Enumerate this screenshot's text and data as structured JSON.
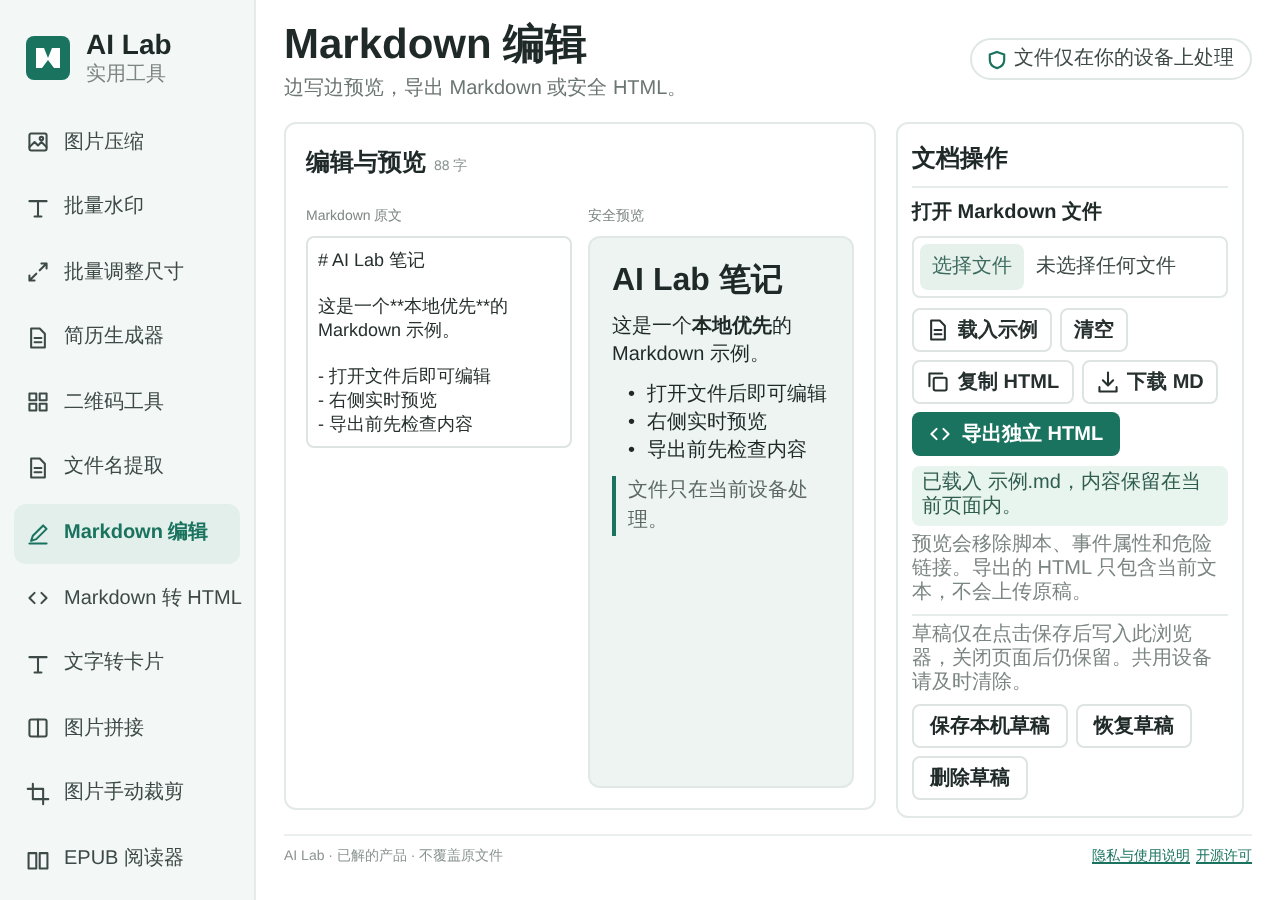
{
  "brand": {
    "name": "AI Lab",
    "subtitle": "实用工具"
  },
  "sidebar": {
    "items": [
      {
        "label": "图片压缩",
        "selected": false
      },
      {
        "label": "批量水印",
        "selected": false
      },
      {
        "label": "批量调整尺寸",
        "selected": false
      },
      {
        "label": "简历生成器",
        "selected": false
      },
      {
        "label": "二维码工具",
        "selected": false
      },
      {
        "label": "文件名提取",
        "selected": false
      },
      {
        "label": "Markdown 编辑",
        "selected": true
      },
      {
        "label": "Markdown 转 HTML",
        "selected": false
      },
      {
        "label": "文字转卡片",
        "selected": false
      },
      {
        "label": "图片拼接",
        "selected": false
      },
      {
        "label": "图片手动裁剪",
        "selected": false
      },
      {
        "label": "EPUB 阅读器",
        "selected": false
      }
    ]
  },
  "header": {
    "title": "Markdown 编辑",
    "subtitle": "边写边预览，导出 Markdown 或安全 HTML。",
    "badge": "文件仅在你的设备上处理"
  },
  "editor": {
    "title": "编辑与预览",
    "count": "88 字",
    "source_label": "Markdown 原文",
    "source_lines": [
      "# AI Lab 笔记",
      "这是一个**本地优先**的 Markdown 示例。",
      "- 打开文件后即可编辑",
      "- 右侧实时预览",
      "- 导出前先检查内容"
    ],
    "preview_label": "安全预览",
    "preview": {
      "heading": "AI Lab 笔记",
      "paragraph": "这是一个**本地优先**的 Markdown 示例。",
      "list": [
        {
          "marker": "•",
          "text": "打开文件后即可编辑"
        },
        {
          "marker": "•",
          "text": "右侧实时预览"
        },
        {
          "marker": "•",
          "text": "导出前先检查内容"
        }
      ],
      "quote": "文件只在当前设备处理。"
    }
  },
  "actions": {
    "title": "文档操作",
    "file_label": "打开 Markdown 文件",
    "file_button": "选择文件",
    "file_status": "未选择任何文件",
    "buttons": [
      {
        "label": "载入示例",
        "kind": "load"
      },
      {
        "label": "清空",
        "kind": "plain"
      },
      {
        "label": "复制 HTML",
        "kind": "copy"
      },
      {
        "label": "下载 MD",
        "kind": "download"
      },
      {
        "label": "导出独立 HTML",
        "kind": "primary"
      }
    ],
    "notice": "已载入 示例.md，内容保留在当前页面内。",
    "note": "预览会移除脚本、事件属性和危险链接。导出的 HTML 只包含当前文本，不会上传原稿。",
    "draft_note": "草稿仅在点击保存后写入此浏览器，关闭页面后仍保留。共用设备请及时清除。",
    "draft_buttons": [
      "保存本机草稿",
      "恢复草稿",
      "删除草稿"
    ]
  },
  "footer": {
    "text": "AI Lab · 已解的产品 · 不覆盖原文件",
    "links": [
      "隐私与使用说明",
      "开源许可"
    ]
  }
}
